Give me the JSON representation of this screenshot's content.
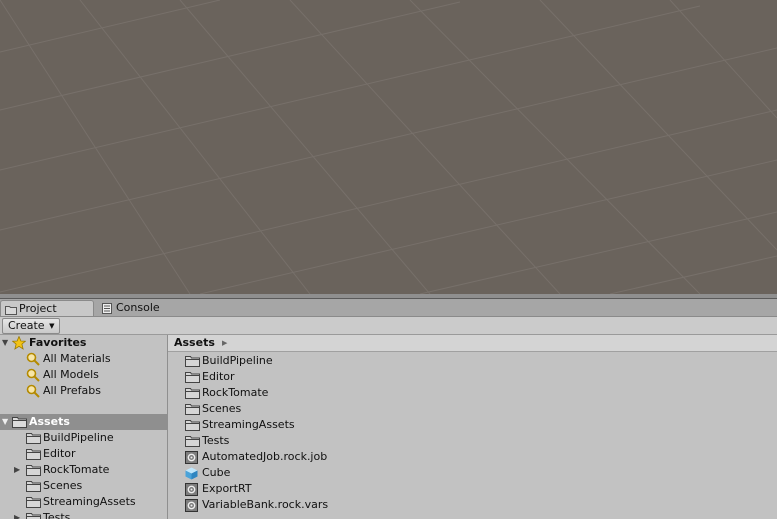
{
  "tabs": {
    "project": {
      "label": "Project",
      "icon": "folder-icon"
    },
    "console": {
      "label": "Console",
      "icon": "console-icon"
    }
  },
  "toolbar": {
    "create_label": "Create"
  },
  "sidebar": {
    "favorites": {
      "label": "Favorites",
      "icon": "star-icon",
      "items": [
        {
          "label": "All Materials",
          "icon": "search-icon"
        },
        {
          "label": "All Models",
          "icon": "search-icon"
        },
        {
          "label": "All Prefabs",
          "icon": "search-icon"
        }
      ]
    },
    "assets": {
      "label": "Assets",
      "icon": "folder-icon",
      "items": [
        {
          "label": "BuildPipeline",
          "icon": "folder-icon",
          "expandable": false
        },
        {
          "label": "Editor",
          "icon": "folder-icon",
          "expandable": false
        },
        {
          "label": "RockTomate",
          "icon": "folder-icon",
          "expandable": true
        },
        {
          "label": "Scenes",
          "icon": "folder-icon",
          "expandable": false
        },
        {
          "label": "StreamingAssets",
          "icon": "folder-icon",
          "expandable": false
        },
        {
          "label": "Tests",
          "icon": "folder-icon",
          "expandable": true
        }
      ]
    }
  },
  "content": {
    "breadcrumb": "Assets",
    "items": [
      {
        "label": "BuildPipeline",
        "icon": "folder-icon"
      },
      {
        "label": "Editor",
        "icon": "folder-icon"
      },
      {
        "label": "RockTomate",
        "icon": "folder-icon"
      },
      {
        "label": "Scenes",
        "icon": "folder-icon"
      },
      {
        "label": "StreamingAssets",
        "icon": "folder-icon"
      },
      {
        "label": "Tests",
        "icon": "folder-icon"
      },
      {
        "label": "AutomatedJob.rock.job",
        "icon": "scriptable-object-icon"
      },
      {
        "label": "Cube",
        "icon": "cube-icon"
      },
      {
        "label": "ExportRT",
        "icon": "scriptable-object-icon"
      },
      {
        "label": "VariableBank.rock.vars",
        "icon": "scriptable-object-icon"
      }
    ]
  },
  "colors": {
    "scene_background": "#6a635c",
    "selection": "#8f8f8f",
    "panel_background": "#c2c2c2"
  }
}
